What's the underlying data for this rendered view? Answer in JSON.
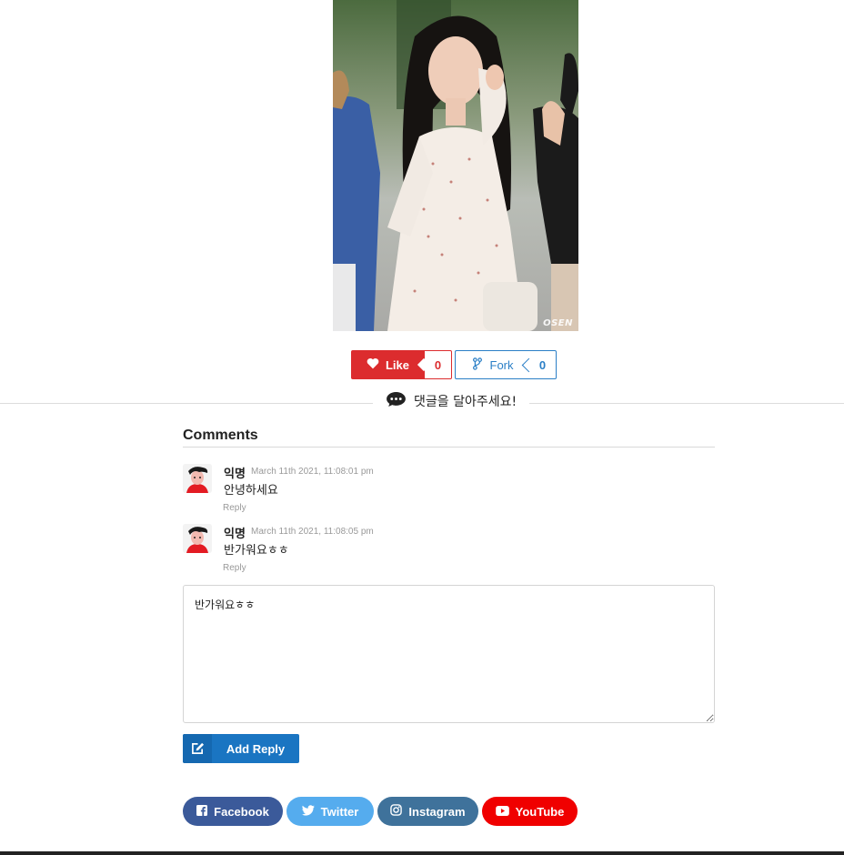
{
  "photo": {
    "watermark": "OSEN"
  },
  "like": {
    "label": "Like",
    "count": "0"
  },
  "fork": {
    "label": "Fork",
    "count": "0"
  },
  "divider": {
    "label": "댓글을 달아주세요!"
  },
  "comments": {
    "title": "Comments",
    "items": [
      {
        "author": "익명",
        "date": "March 11th 2021, 11:08:01 pm",
        "text": "안녕하세요",
        "reply": "Reply"
      },
      {
        "author": "익명",
        "date": "March 11th 2021, 11:08:05 pm",
        "text": "반가워요ㅎㅎ",
        "reply": "Reply"
      }
    ]
  },
  "reply_form": {
    "value": "반가워요ㅎㅎ",
    "button_label": "Add Reply"
  },
  "social": {
    "facebook": "Facebook",
    "twitter": "Twitter",
    "instagram": "Instagram",
    "youtube": "YouTube"
  },
  "colors": {
    "like": "#dc2c2e",
    "fork": "#2b7fc6",
    "add_reply": "#1a75c2",
    "facebook": "#3b5a9a",
    "twitter": "#55acee",
    "instagram": "#3f729b",
    "youtube": "#f00000"
  }
}
